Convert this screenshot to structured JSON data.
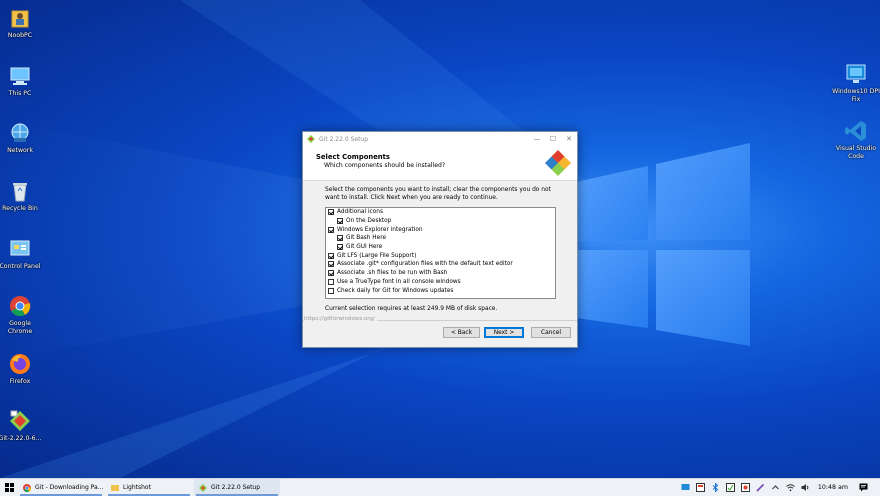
{
  "desktop": {
    "icons": [
      {
        "label": "NoobPC"
      },
      {
        "label": "This PC"
      },
      {
        "label": "Network"
      },
      {
        "label": "Recycle Bin"
      },
      {
        "label": "Control Panel"
      },
      {
        "label": "Google Chrome"
      },
      {
        "label": "Firefox"
      },
      {
        "label": "Git-2.22.0-6..."
      },
      {
        "label": "Windows10 DPI Fix"
      },
      {
        "label": "Visual Studio Code"
      }
    ]
  },
  "window": {
    "title": "Git 2.22.0 Setup",
    "controls": {
      "minimize": "—",
      "maximize": "☐",
      "close": "✕"
    },
    "header": {
      "title": "Select Components",
      "subtitle": "Which components should be installed?"
    },
    "description": "Select the components you want to install; clear the components you do not want to install. Click Next when you are ready to continue.",
    "components": [
      {
        "label": "Additional icons",
        "checked": true,
        "indent": 0
      },
      {
        "label": "On the Desktop",
        "checked": true,
        "indent": 1
      },
      {
        "label": "Windows Explorer integration",
        "checked": true,
        "indent": 0
      },
      {
        "label": "Git Bash Here",
        "checked": true,
        "indent": 1
      },
      {
        "label": "Git GUI Here",
        "checked": true,
        "indent": 1
      },
      {
        "label": "Git LFS (Large File Support)",
        "checked": true,
        "indent": 0
      },
      {
        "label": "Associate .git* configuration files with the default text editor",
        "checked": true,
        "indent": 0
      },
      {
        "label": "Associate .sh files to be run with Bash",
        "checked": true,
        "indent": 0
      },
      {
        "label": "Use a TrueType font in all console windows",
        "checked": false,
        "indent": 0
      },
      {
        "label": "Check daily for Git for Windows updates",
        "checked": false,
        "indent": 0
      }
    ],
    "disk_space": "Current selection requires at least 249.9 MB of disk space.",
    "link": "https://gitforwindows.org/",
    "buttons": {
      "back": "< Back",
      "next": "Next >",
      "cancel": "Cancel"
    }
  },
  "taskbar": {
    "tasks": [
      {
        "label": "Git - Downloading Pa...",
        "icon": "chrome-icon",
        "active": false
      },
      {
        "label": "Lightshot",
        "icon": "folder-icon",
        "active": false
      },
      {
        "label": "Git 2.22.0 Setup",
        "icon": "git-icon",
        "active": true
      }
    ],
    "clock": "10:48 am"
  },
  "colors": {
    "accent": "#0078d7",
    "desktop": "#0a46c4",
    "git_red": "#e0402c"
  }
}
